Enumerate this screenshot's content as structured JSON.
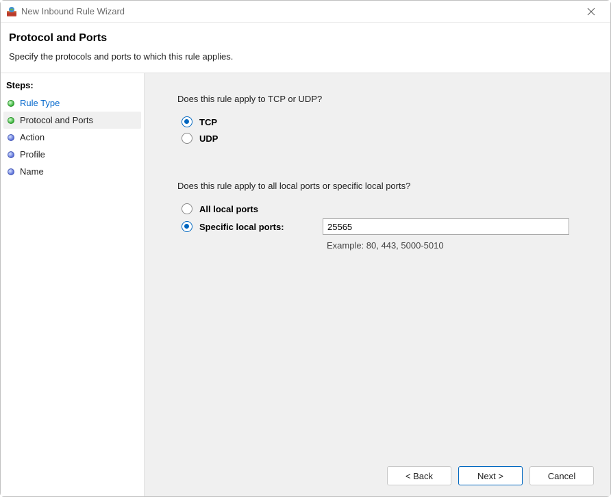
{
  "window": {
    "title": "New Inbound Rule Wizard"
  },
  "header": {
    "title": "Protocol and Ports",
    "subtitle": "Specify the protocols and ports to which this rule applies."
  },
  "sidebar": {
    "heading": "Steps:",
    "items": [
      {
        "label": "Rule Type",
        "link": true,
        "current": false,
        "bullet": "green"
      },
      {
        "label": "Protocol and Ports",
        "link": false,
        "current": true,
        "bullet": "green"
      },
      {
        "label": "Action",
        "link": false,
        "current": false,
        "bullet": "blue"
      },
      {
        "label": "Profile",
        "link": false,
        "current": false,
        "bullet": "blue"
      },
      {
        "label": "Name",
        "link": false,
        "current": false,
        "bullet": "blue"
      }
    ]
  },
  "content": {
    "question1": "Does this rule apply to TCP or UDP?",
    "protocol_options": {
      "tcp": "TCP",
      "udp": "UDP",
      "selected": "tcp"
    },
    "question2": "Does this rule apply to all local ports or specific local ports?",
    "port_options": {
      "all": "All local ports",
      "specific": "Specific local ports:",
      "selected": "specific"
    },
    "port_value": "25565",
    "port_example": "Example: 80, 443, 5000-5010"
  },
  "footer": {
    "back": "< Back",
    "next": "Next >",
    "cancel": "Cancel"
  }
}
